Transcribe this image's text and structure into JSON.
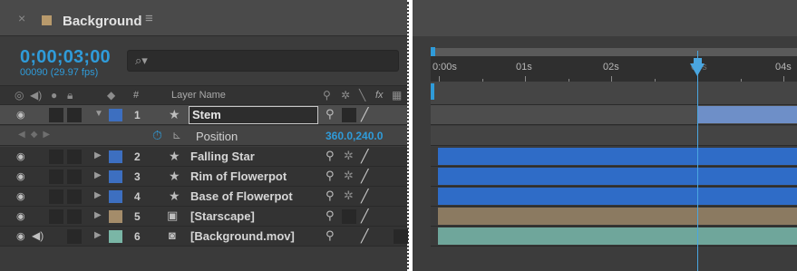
{
  "header": {
    "close_symbol": "×",
    "title": "Background",
    "menu_symbol": "≡",
    "comp_color": "#b89a6c"
  },
  "time": {
    "timecode": "0;00;03;00",
    "frames": "00090 (29.97 fps)"
  },
  "search": {
    "placeholder": "",
    "icon": "search-icon"
  },
  "columns": {
    "layer_name": "Layer Name",
    "number": "#",
    "switches": "fx"
  },
  "layers": [
    {
      "num": "1",
      "name": "Stem",
      "color": "#3d6fc0",
      "type": "shape",
      "selected": true,
      "editing": true
    },
    {
      "num": "2",
      "name": "Falling Star",
      "color": "#3d6fc0",
      "type": "shape"
    },
    {
      "num": "3",
      "name": "Rim of Flowerpot",
      "color": "#3d6fc0",
      "type": "shape"
    },
    {
      "num": "4",
      "name": "Base of Flowerpot",
      "color": "#3d6fc0",
      "type": "shape"
    },
    {
      "num": "5",
      "name": "[Starscape]",
      "color": "#a48c6a",
      "type": "image"
    },
    {
      "num": "6",
      "name": "[Background.mov]",
      "color": "#7ab6a6",
      "type": "footage"
    }
  ],
  "property": {
    "name": "Position",
    "value": "360.0,240.0"
  },
  "timeline": {
    "ticks": [
      "0:00s",
      "01s",
      "02s",
      "03s",
      "04s"
    ],
    "playhead_time": "03s",
    "bar_colors": {
      "shape": "#2f6cc7",
      "stem_partial": "#6e8fc8",
      "image": "#8b7a61",
      "footage": "#6fa69b"
    }
  }
}
